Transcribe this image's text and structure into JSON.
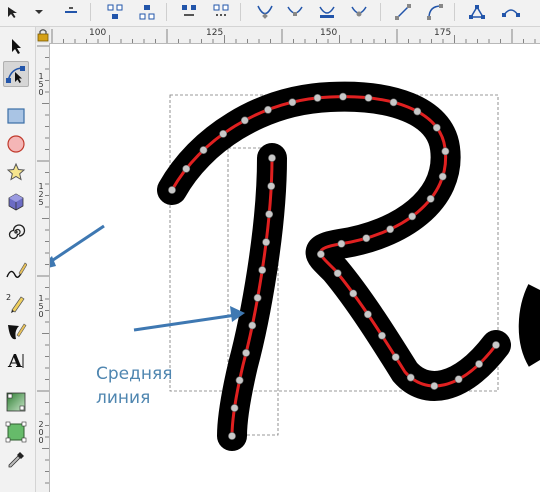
{
  "toolbar": {
    "buttons": [
      {
        "name": "dropdown-arrow-icon"
      },
      {
        "name": "delete-node-icon"
      },
      {
        "name": "join-nodes-icon"
      },
      {
        "name": "break-path-icon"
      },
      {
        "name": "join-segment-icon"
      },
      {
        "name": "delete-segment-icon"
      },
      {
        "name": "node-cusp-icon"
      },
      {
        "name": "node-smooth-icon"
      },
      {
        "name": "node-symmetric-icon"
      },
      {
        "name": "node-auto-icon"
      },
      {
        "name": "segment-line-icon"
      },
      {
        "name": "segment-curve-icon"
      },
      {
        "name": "object-to-path-icon"
      }
    ]
  },
  "ruler": {
    "horizontal_labels": [
      "100",
      "125",
      "150",
      "175"
    ],
    "vertical_labels": [
      "1",
      "5",
      "0",
      "1",
      "2",
      "5",
      "1",
      "5",
      "0",
      "1",
      "2",
      "5",
      "2",
      "0",
      "0"
    ]
  },
  "tools": [
    {
      "name": "selector-tool-icon"
    },
    {
      "name": "node-tool-icon",
      "active": true
    },
    {
      "name": "rectangle-tool-icon"
    },
    {
      "name": "ellipse-tool-icon"
    },
    {
      "name": "star-tool-icon"
    },
    {
      "name": "3d-box-tool-icon"
    },
    {
      "name": "spiral-tool-icon"
    },
    {
      "name": "pencil-tool-icon"
    },
    {
      "name": "pen-tool-icon"
    },
    {
      "name": "calligraphy-tool-icon"
    },
    {
      "name": "text-tool-icon"
    },
    {
      "name": "gradient-tool-icon"
    },
    {
      "name": "mesh-tool-icon"
    },
    {
      "name": "dropper-tool-icon"
    }
  ],
  "annotation": {
    "line1": "Средняя",
    "line2": "линия",
    "arrow_color": "#3e78b2"
  },
  "colors": {
    "stroke": "#000000",
    "centerline": "#e02020",
    "node": "#c8c8c8"
  }
}
